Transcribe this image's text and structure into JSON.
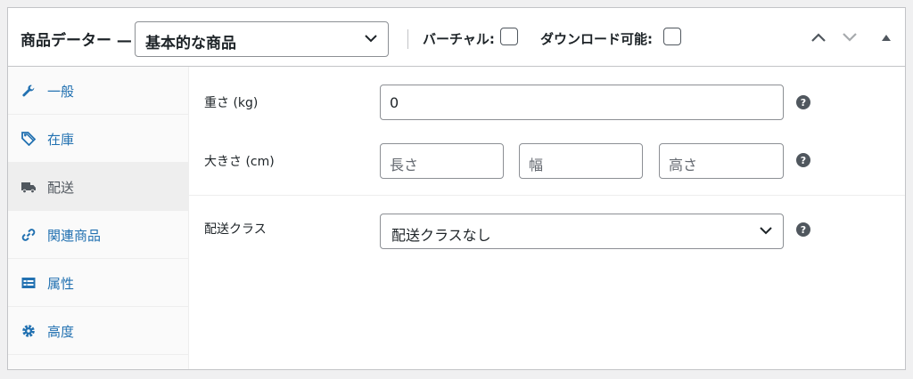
{
  "header": {
    "title": "商品データー",
    "product_type": "基本的な商品",
    "virtual_label": "バーチャル:",
    "downloadable_label": "ダウンロード可能:"
  },
  "sidebar": {
    "items": [
      {
        "label": "一般",
        "icon": "wrench-icon"
      },
      {
        "label": "在庫",
        "icon": "tag-icon"
      },
      {
        "label": "配送",
        "icon": "truck-icon",
        "active": true
      },
      {
        "label": "関連商品",
        "icon": "link-icon"
      },
      {
        "label": "属性",
        "icon": "list-icon"
      },
      {
        "label": "高度",
        "icon": "gear-icon"
      }
    ]
  },
  "shipping": {
    "weight_label": "重さ (kg)",
    "weight_value": "0",
    "dimensions_label": "大きさ (cm)",
    "length_placeholder": "長さ",
    "width_placeholder": "幅",
    "height_placeholder": "高さ",
    "class_label": "配送クラス",
    "class_value": "配送クラスなし"
  },
  "colors": {
    "link": "#2271b1",
    "active_tab_bg": "#eeeeee",
    "border": "#c3c4c7"
  }
}
